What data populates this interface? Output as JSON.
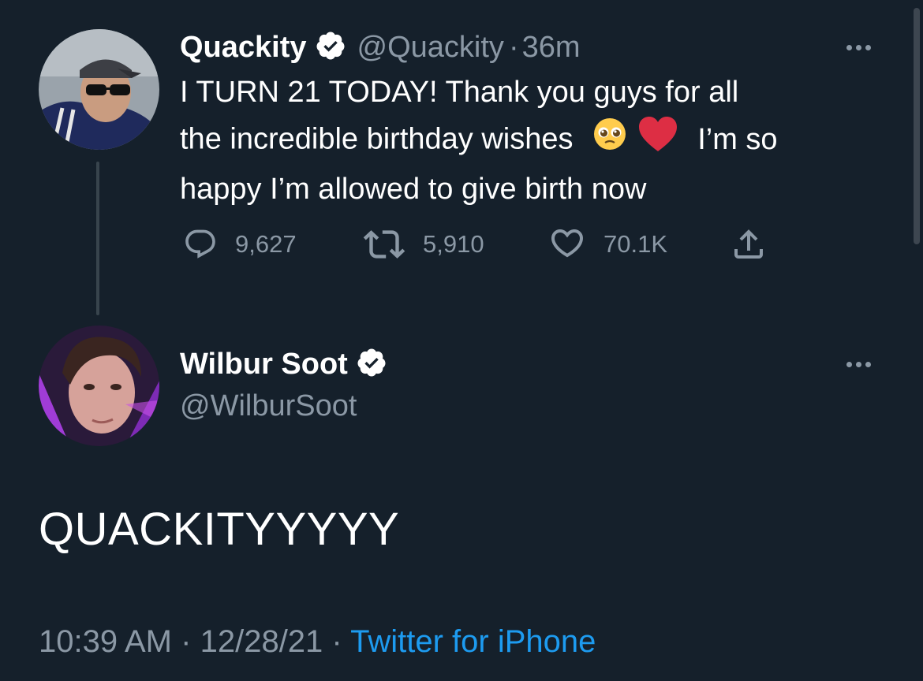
{
  "parent_tweet": {
    "name": "Quackity",
    "handle": "@Quackity",
    "separator": "·",
    "time": "36m",
    "text_line1": "I TURN 21 TODAY! Thank you guys for all",
    "text_line2a": "the incredible birthday wishes",
    "text_line2b": "I’m so",
    "text_line3": "happy I’m allowed to give birth now",
    "replies": "9,627",
    "retweets": "5,910",
    "likes": "70.1K"
  },
  "reply_tweet": {
    "name": "Wilbur Soot",
    "handle": "@WilburSoot",
    "text": "QUACKITYYYYY",
    "time": "10:39 AM",
    "sep1": "·",
    "date": "12/28/21",
    "sep2": "·",
    "source": "Twitter for iPhone"
  },
  "colors": {
    "background": "#15202b",
    "secondary_text": "#8b98a5",
    "link": "#1d9bf0",
    "thread_line": "#38444d"
  },
  "icons": [
    "reply-icon",
    "retweet-icon",
    "like-icon",
    "share-icon",
    "verified-icon",
    "more-icon",
    "pleading-face-emoji",
    "red-heart-emoji"
  ]
}
